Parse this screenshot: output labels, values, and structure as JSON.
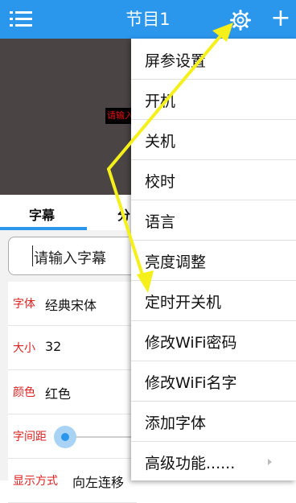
{
  "header": {
    "title": "节目1"
  },
  "preview": {
    "text": "请输入"
  },
  "tabs": [
    {
      "label": "字幕"
    },
    {
      "label": "分"
    }
  ],
  "subtitle_input": {
    "placeholder": "请输入字幕"
  },
  "settings": {
    "font": {
      "label": "字体",
      "value": "经典宋体"
    },
    "size": {
      "label": "大小",
      "value": "32"
    },
    "color": {
      "label": "颜色",
      "value": "红色"
    },
    "spacing": {
      "label": "字间距"
    },
    "display": {
      "label": "显示方式",
      "value": "向左连移"
    }
  },
  "menu": {
    "items": [
      {
        "label": "屏参设置"
      },
      {
        "label": "开机"
      },
      {
        "label": "关机"
      },
      {
        "label": "校时"
      },
      {
        "label": "语言"
      },
      {
        "label": "亮度调整"
      },
      {
        "label": "定时开关机"
      },
      {
        "label": "修改WiFi密码"
      },
      {
        "label": "修改WiFi名字"
      },
      {
        "label": "添加字体"
      },
      {
        "label": "高级功能......"
      }
    ]
  },
  "colors": {
    "primary": "#2a96ec",
    "label_red": "#dd2222",
    "annotation": "#f5ef1a"
  },
  "icons": {
    "menu": "hamburger-icon",
    "settings": "gear-icon",
    "add": "plus-icon",
    "submenu": "chevron-right-icon"
  }
}
